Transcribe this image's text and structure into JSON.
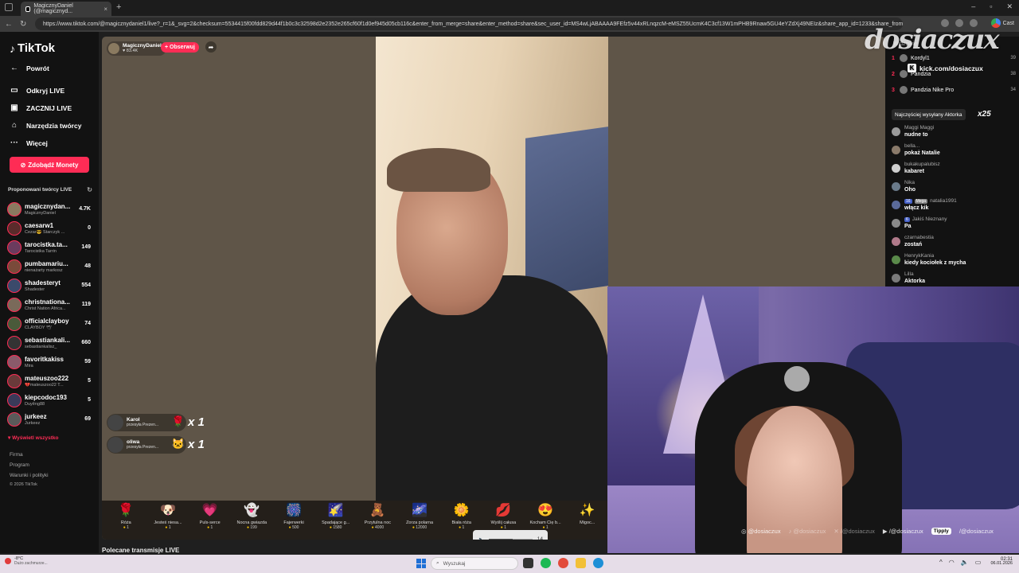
{
  "browser": {
    "tab_title": "MagicznyDaniel (@magicznyd...",
    "url": "https://www.tiktok.com/@magicznydaniel1/live?_r=1&_svg=2&checksum=5534415f00fdd829d44f1b0c3c32598d2e2352e265cf60f1d0ef945d05cb116c&enter_from_merge=share&enter_method=share&sec_user_id=MS4wLjABAAAA9FEfz5v44xRLnqzcM-eMSZ55UcmK4C3cf13W1mPHB9Rnaw5GU4eYZdXj49NEIz&share_app_id=1233&share_from_u...",
    "cast_label": "Cast"
  },
  "sidebar": {
    "logo": "TikTok",
    "nav": [
      {
        "label": "Powrót",
        "icon": "back-arrow-icon",
        "glyph": "←"
      },
      {
        "label": "Odkryj LIVE",
        "icon": "live-tv-icon",
        "glyph": "▭"
      },
      {
        "label": "ZACZNIJ LIVE",
        "icon": "camera-icon",
        "glyph": "▣"
      },
      {
        "label": "Narzędzia twórcy",
        "icon": "home-tools-icon",
        "glyph": "⌂"
      },
      {
        "label": "Więcej",
        "icon": "more-icon",
        "glyph": "···"
      }
    ],
    "coins_button": "Zdobądź Monety",
    "proposed_header": "Proponowani twórcy LIVE",
    "creators": [
      {
        "name": "magicznydan...",
        "sub": "MagicznyDaniel",
        "count": "4.7K",
        "color": "#8a7a60"
      },
      {
        "name": "caesarw1",
        "sub": "Cezar😎 Starczyk ...",
        "count": "0",
        "color": "#5a2b2b"
      },
      {
        "name": "tarocistka.ta...",
        "sub": "Tarocistka Tarrin",
        "count": "149",
        "color": "#6b3b5e"
      },
      {
        "name": "pumbamariu...",
        "sub": "nienażarty markosz",
        "count": "48",
        "color": "#7a4a3a"
      },
      {
        "name": "shadesteryt",
        "sub": "Shadester",
        "count": "554",
        "color": "#3b4a6b"
      },
      {
        "name": "christnationa...",
        "sub": "Christ Nation Africa...",
        "count": "119",
        "color": "#7a6a5a"
      },
      {
        "name": "officialclayboy",
        "sub": "CLAYBOY 🕊",
        "count": "74",
        "color": "#4a5a3a"
      },
      {
        "name": "sebastiankali...",
        "sub": "sebastiankalisz_",
        "count": "660",
        "color": "#333333"
      },
      {
        "name": "favoritkakiss",
        "sub": "Mira",
        "count": "59",
        "color": "#8a5a6a"
      },
      {
        "name": "mateuszoo222",
        "sub": "💔mateuszoo22 T...",
        "count": "5",
        "color": "#6a3a3a"
      },
      {
        "name": "kiepcodoc193",
        "sub": "Duyêng88",
        "count": "5",
        "color": "#3a3a5a"
      },
      {
        "name": "jurkeez",
        "sub": "Jurkeez",
        "count": "69",
        "color": "#5a5a5a"
      }
    ],
    "show_all": "Wyświetl wszystko",
    "footer": [
      "Firma",
      "Program",
      "Warunki i polityki",
      "© 2026 TikTok"
    ]
  },
  "player": {
    "host_name": "MagicznyDaniel",
    "host_likes": "83.4K",
    "follow_label": "+ Obserwuj",
    "gift_popups": [
      {
        "name": "Karol",
        "text": "przesyła Prezen...",
        "icon": "🌹",
        "mult": "x 1"
      },
      {
        "name": "oliwa",
        "text": "przesyła Prezen...",
        "icon": "🐱",
        "mult": "x 1"
      }
    ],
    "gifts": [
      {
        "name": "Róża",
        "price": "1",
        "icon": "🌹"
      },
      {
        "name": "Jesteś niesa...",
        "price": "1",
        "icon": "🐶"
      },
      {
        "name": "Puls-serce",
        "price": "1",
        "icon": "💗"
      },
      {
        "name": "Nocna gwiazda",
        "price": "199",
        "icon": "👻"
      },
      {
        "name": "Fajerwerki",
        "price": "500",
        "icon": "🎆"
      },
      {
        "name": "Spadające g...",
        "price": "1580",
        "icon": "🌠"
      },
      {
        "name": "Przytulna noc",
        "price": "4000",
        "icon": "🧸"
      },
      {
        "name": "Zorza polarna",
        "price": "12000",
        "icon": "🌌"
      },
      {
        "name": "Biała róża",
        "price": "1",
        "icon": "🌼"
      },
      {
        "name": "Wyślij całusa",
        "price": "1",
        "icon": "💋"
      },
      {
        "name": "Kocham Cię b...",
        "price": "1",
        "icon": "😍"
      },
      {
        "name": "Migoc...",
        "price": "",
        "icon": "✨"
      }
    ],
    "volume_value": "14",
    "volume_level": 0.55
  },
  "chat": {
    "rank_header": "Widzowie",
    "ranking": [
      {
        "rank": "1",
        "name": "Kordyl1",
        "score": "39"
      },
      {
        "rank": "2",
        "name": "Pandzia",
        "score": "38"
      },
      {
        "rank": "3",
        "name": "Pandzia Nike Pro",
        "score": "34"
      }
    ],
    "kick_overlay": "kick.com/dosiaczux",
    "top_gift": "Najczęściej wysyłany Aktorka",
    "top_gift_mult": "x25",
    "messages": [
      {
        "user": "Maggi Maggi",
        "text": "nudne to",
        "badge": "",
        "badge2": ""
      },
      {
        "user": "bella...",
        "text": "pokaż Natalie",
        "badge": "",
        "badge2": ""
      },
      {
        "user": "bukakupalubisz",
        "text": "kabaret",
        "badge": "",
        "badge2": ""
      },
      {
        "user": "Nika",
        "text": "Oho",
        "badge": "",
        "badge2": ""
      },
      {
        "user": "natalia1991",
        "text": "włącz kik",
        "badge": "16",
        "badge2": "Mega"
      },
      {
        "user": "Jakiś Nieznany",
        "text": "Pa",
        "badge": "6",
        "badge2": ""
      },
      {
        "user": "czarnabestia",
        "text": "zostań",
        "badge": "",
        "badge2": ""
      },
      {
        "user": "HenrykKania",
        "text": "kiedy kociołek z mycha",
        "badge": "",
        "badge2": ""
      },
      {
        "user": "Lilla",
        "text": "Aktorka",
        "badge": "",
        "badge2": ""
      }
    ]
  },
  "webcam": {
    "watermark": "dosiaczux",
    "socials": [
      "@dosiaczux",
      "@dosiaczux",
      "/@dosiaczux",
      "/@dosiaczux"
    ],
    "tipply": "Tipply"
  },
  "below_player": "Polecane transmisje LIVE",
  "taskbar": {
    "weather_temp": "-8°C",
    "weather_desc": "Dużo zachmurze...",
    "search_placeholder": "Wyszukaj",
    "time": "02:31",
    "date": "06.01.2026"
  }
}
